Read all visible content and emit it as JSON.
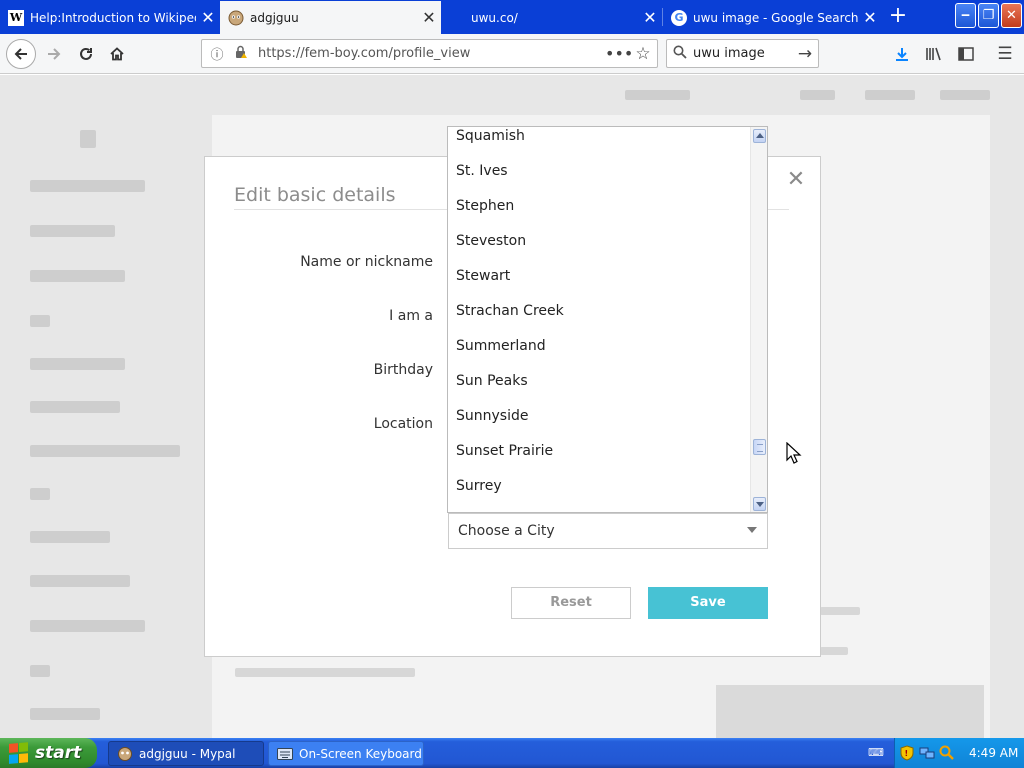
{
  "browser": {
    "tabs": [
      {
        "title": "Help:Introduction to Wikipedia - W",
        "icon": "wikipedia-icon",
        "active": false
      },
      {
        "title": "adgjguu",
        "icon": "mypal-site-icon",
        "active": true
      },
      {
        "title": "uwu.co/",
        "icon": "blank-page-icon",
        "active": false
      },
      {
        "title": "uwu image - Google Search",
        "icon": "google-icon",
        "active": false
      }
    ],
    "url": "https://fem-boy.com/profile_view",
    "search_value": "uwu image"
  },
  "modal": {
    "title": "Edit basic details",
    "labels": {
      "name": "Name or nickname",
      "gender": "I am a",
      "birthday": "Birthday",
      "location": "Location"
    },
    "city_select": {
      "value": "Choose a City"
    },
    "city_options": [
      "Squamish",
      "St. Ives",
      "Stephen",
      "Steveston",
      "Stewart",
      "Strachan Creek",
      "Summerland",
      "Sun Peaks",
      "Sunnyside",
      "Sunset Prairie",
      "Surrey"
    ],
    "reset_label": "Reset",
    "save_label": "Save"
  },
  "taskbar": {
    "start_label": "start",
    "tasks": [
      {
        "label": "adgjguu - Mypal",
        "icon": "mypal-icon"
      },
      {
        "label": "On-Screen Keyboard",
        "icon": "keyboard-icon"
      }
    ],
    "clock": "4:49 AM"
  },
  "colors": {
    "titlebar": "#0a3fd6",
    "save_button": "#47c2d4",
    "taskbar": "#245edb",
    "start_button": "#3c9b3a"
  }
}
